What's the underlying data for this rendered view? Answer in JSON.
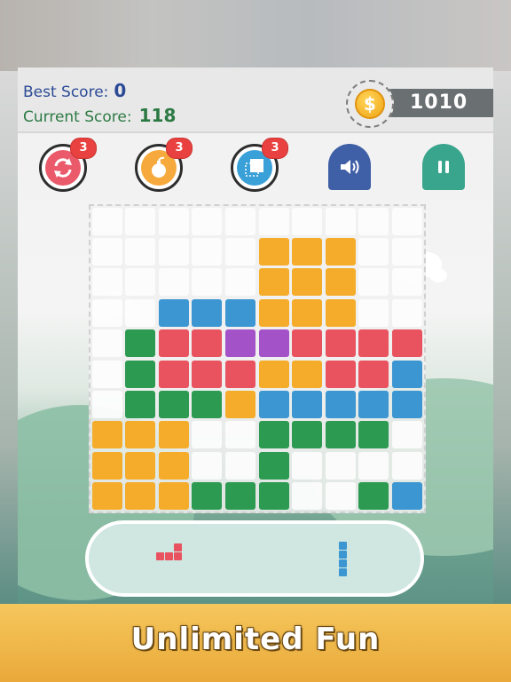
{
  "scores": {
    "best_label": "Best Score:",
    "best_value": "0",
    "current_label": "Current Score:",
    "current_value": "118"
  },
  "coins": {
    "amount": "1010",
    "symbol": "$"
  },
  "tools": [
    {
      "name": "refresh",
      "icon": "refresh-icon",
      "count": "3",
      "color": "#ea5a6b"
    },
    {
      "name": "bomb",
      "icon": "bomb-icon",
      "count": "3",
      "color": "#f6a93c"
    },
    {
      "name": "single-block",
      "icon": "square-icon",
      "count": "3",
      "color": "#3aa0d8"
    }
  ],
  "controls": [
    {
      "name": "sound",
      "icon": "speaker-icon",
      "color": "#3f5fa6"
    },
    {
      "name": "pause",
      "icon": "pause-icon",
      "color": "#3aa58d"
    }
  ],
  "colors": {
    "orange": "#f5ac2a",
    "blue": "#3b96d2",
    "red": "#e8535f",
    "purple": "#a452c8",
    "green": "#2d9a52"
  },
  "board": {
    "cols": 10,
    "rows": 10,
    "cells": [
      [
        null,
        null,
        null,
        null,
        null,
        null,
        null,
        null,
        null,
        null
      ],
      [
        null,
        null,
        null,
        null,
        null,
        "orange",
        "orange",
        "orange",
        null,
        null
      ],
      [
        null,
        null,
        null,
        null,
        null,
        "orange",
        "orange",
        "orange",
        null,
        null
      ],
      [
        null,
        null,
        "blue",
        "blue",
        "blue",
        "orange",
        "orange",
        "orange",
        null,
        null
      ],
      [
        null,
        "green",
        "red",
        "red",
        "purple",
        "purple",
        "red",
        "red",
        "red",
        "red"
      ],
      [
        null,
        "green",
        "red",
        "red",
        "red",
        "orange",
        "orange",
        "red",
        "red",
        "blue"
      ],
      [
        null,
        "green",
        "green",
        "green",
        "orange",
        "blue",
        "blue",
        "blue",
        "blue",
        "blue"
      ],
      [
        "orange",
        "orange",
        "orange",
        null,
        null,
        "green",
        "green",
        "green",
        "green",
        null
      ],
      [
        "orange",
        "orange",
        "orange",
        null,
        null,
        "green",
        null,
        null,
        null,
        null
      ],
      [
        "orange",
        "orange",
        "orange",
        "green",
        "green",
        "green",
        null,
        null,
        "green",
        "blue"
      ]
    ]
  },
  "next_pieces": [
    {
      "name": "red-tri",
      "color": "red",
      "cells": [
        [
          0,
          2
        ],
        [
          1,
          0
        ],
        [
          1,
          1
        ],
        [
          1,
          2
        ]
      ]
    },
    {
      "name": "blue-bar",
      "color": "blue",
      "cells": [
        [
          0,
          0
        ],
        [
          1,
          0
        ],
        [
          2,
          0
        ],
        [
          3,
          0
        ]
      ]
    }
  ],
  "banner": {
    "text": "Unlimited Fun"
  }
}
